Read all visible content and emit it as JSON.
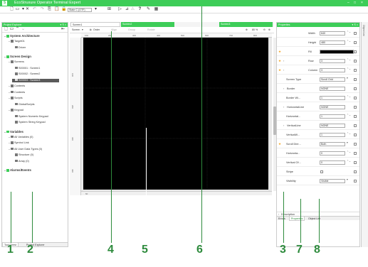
{
  "window": {
    "title": "EcoStruxure Operator Terminal Expert",
    "logo": "S",
    "controls": [
      "–",
      "□",
      "×"
    ]
  },
  "toolbar": {
    "state_select": "State C (OTF)",
    "icons": [
      "new-icon",
      "save-icon",
      "dropdown-icon",
      "cut-icon",
      "undo-icon",
      "redo-icon",
      "copy-icon",
      "paste-icon",
      "lock-icon",
      "grid-icon",
      "play-icon",
      "build-icon",
      "warning-icon",
      "help-icon",
      "pin-icon",
      "arrange-icon"
    ]
  },
  "project_explorer": {
    "title": "Project Explorer",
    "header_controls": "▾ ⊼ ×",
    "toolbar_icons": [
      "document-icon",
      "folder-icon",
      "up-icon",
      "collapse-icon"
    ],
    "tree": [
      {
        "label": "System Architecture",
        "level": 0,
        "kind": "head"
      },
      {
        "label": "Target01",
        "level": 1,
        "kind": "item"
      },
      {
        "label": "Driver",
        "level": 2,
        "kind": "item"
      },
      {
        "label": "Screen Design",
        "level": 0,
        "kind": "head"
      },
      {
        "label": "Screens",
        "level": 1,
        "kind": "item"
      },
      {
        "label": "S00001 : Screen1",
        "level": 2,
        "kind": "item"
      },
      {
        "label": "S00002 : Screen2",
        "level": 2,
        "kind": "item"
      },
      {
        "label": "S00003 : Screen3",
        "level": 2,
        "kind": "selected"
      },
      {
        "label": "Contents",
        "level": 1,
        "kind": "item"
      },
      {
        "label": "Contents",
        "level": 1,
        "kind": "item"
      },
      {
        "label": "Scripts",
        "level": 1,
        "kind": "item"
      },
      {
        "label": "GlobalScripts",
        "level": 2,
        "kind": "item"
      },
      {
        "label": "Keypad",
        "level": 1,
        "kind": "item"
      },
      {
        "label": "System Numeric Keypad",
        "level": 2,
        "kind": "item"
      },
      {
        "label": "System String Keypad",
        "level": 2,
        "kind": "item"
      },
      {
        "label": "Variables",
        "level": 0,
        "kind": "head"
      },
      {
        "label": "All Variables (0)",
        "level": 1,
        "kind": "item"
      },
      {
        "label": "Symbol Link",
        "level": 1,
        "kind": "item"
      },
      {
        "label": "All User Data Types (0)",
        "level": 1,
        "kind": "item"
      },
      {
        "label": "Structure (0)",
        "level": 2,
        "kind": "item"
      },
      {
        "label": "Array (0)",
        "level": 2,
        "kind": "item"
      },
      {
        "label": "Alarms/Events",
        "level": 0,
        "kind": "head"
      }
    ],
    "bottom_tabs": [
      "Tool Chest",
      "Project Explorer"
    ]
  },
  "editor": {
    "tabs": [
      "Screen1",
      "Screen2",
      "Screen3"
    ],
    "toolbar": {
      "screen": "Screen",
      "order": "Order",
      "align": "Align",
      "group": "Group",
      "rotate": "Rotate",
      "zoom": "80 %"
    },
    "ruler_h": [
      "100",
      "200",
      "300",
      "400",
      "500",
      "600",
      "700",
      "800"
    ],
    "ruler_v": [
      "100",
      "200",
      "300",
      "400"
    ],
    "scroll_label": "60"
  },
  "property_inspector": {
    "title": "Properties",
    "header_controls": "▾ ⊼ ×",
    "rows": [
      {
        "label": "Width",
        "value": "640",
        "type": "spin"
      },
      {
        "label": "Height",
        "value": "480",
        "type": "spin"
      },
      {
        "label": "Fill",
        "value": "",
        "type": "color",
        "star": true
      },
      {
        "label": "Row",
        "value": "3",
        "type": "spin",
        "star": true,
        "expand": true
      },
      {
        "label": "Column",
        "value": "3",
        "type": "spin",
        "star": true,
        "expand": true
      },
      {
        "label": "Screen Type",
        "value": "Scroll Grid",
        "type": "select"
      },
      {
        "label": "Border",
        "value": "NONE",
        "type": "text",
        "expand": true
      },
      {
        "label": "Border Wi...",
        "value": "1",
        "type": "spin"
      },
      {
        "label": "HorizontalLine",
        "value": "NONE",
        "type": "text",
        "expand": true
      },
      {
        "label": "Horizontal...",
        "value": "1",
        "type": "spin"
      },
      {
        "label": "VerticalLine",
        "value": "NONE",
        "type": "text",
        "expand": true
      },
      {
        "label": "VerticalW...",
        "value": "1",
        "type": "spin"
      },
      {
        "label": "Scroll Dire...",
        "value": "Both",
        "type": "select",
        "star": true
      },
      {
        "label": "Horizonta...",
        "value": "0",
        "type": "spin"
      },
      {
        "label": "Vertical Of...",
        "value": "0",
        "type": "spin"
      },
      {
        "label": "Stripe",
        "value": "",
        "type": "check"
      },
      {
        "label": "Visibility",
        "value": "Visible",
        "type": "select"
      }
    ],
    "description_label": "Description",
    "bottom_tabs": [
      "Errors",
      "Properties",
      "Object List"
    ]
  },
  "side_strip": {
    "label": "Object List"
  },
  "callouts": [
    "1",
    "2",
    "3",
    "4",
    "5",
    "6",
    "7",
    "8"
  ],
  "colors": {
    "brand_green": "#3dcd58",
    "callout_green": "#2e8b3d",
    "canvas": "#000000"
  }
}
